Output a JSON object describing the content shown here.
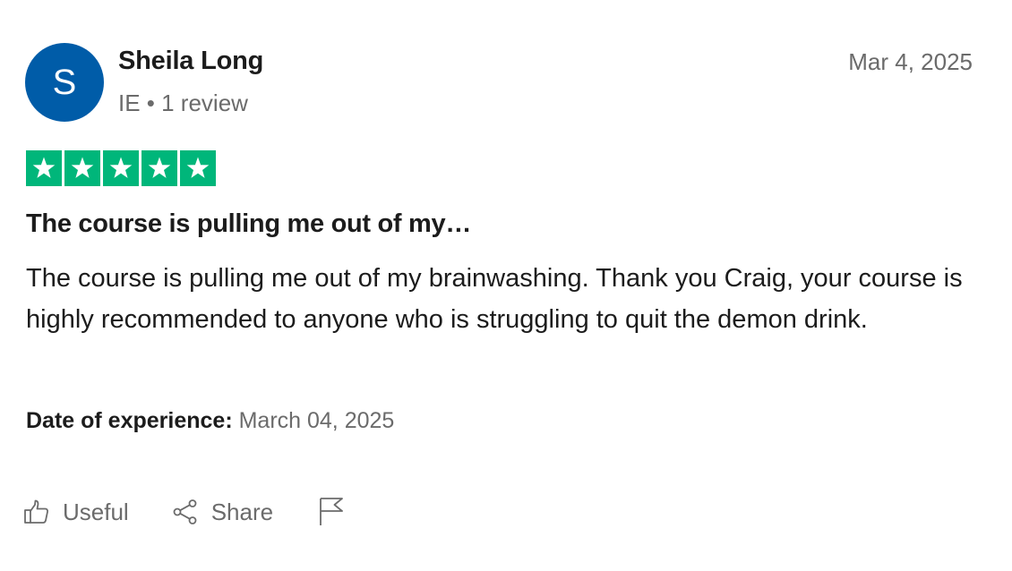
{
  "reviewer": {
    "avatar_initial": "S",
    "name": "Sheila Long",
    "meta": "IE • 1 review",
    "avatar_color": "#005ca8"
  },
  "review": {
    "date": "Mar 4, 2025",
    "rating": 5,
    "rating_max": 5,
    "star_color": "#00b67a",
    "title": "The course is pulling me out of my…",
    "body": "The course is pulling me out of my brainwashing. Thank you Craig, your course is highly recommended to anyone who is struggling to quit the demon drink.",
    "experience_label": "Date of experience:",
    "experience_date": "March 04, 2025"
  },
  "actions": {
    "useful_label": "Useful",
    "share_label": "Share",
    "useful_icon": "thumbs-up-icon",
    "share_icon": "share-icon",
    "report_icon": "flag-icon"
  }
}
